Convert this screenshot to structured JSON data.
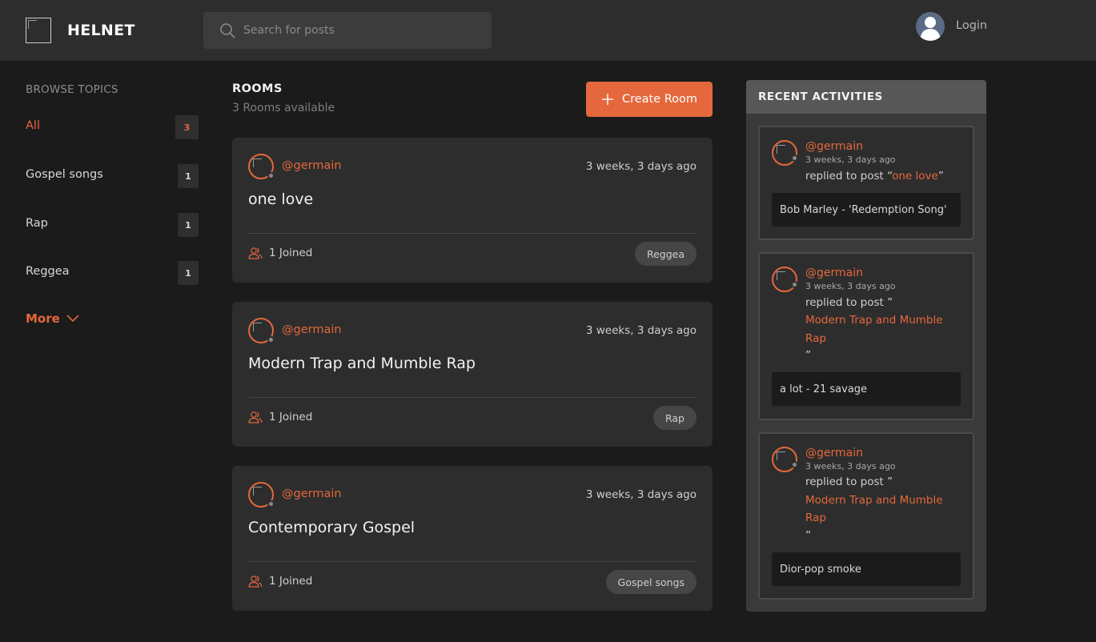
{
  "brand": {
    "name": "HELNET"
  },
  "search": {
    "placeholder": "Search for posts"
  },
  "header": {
    "login_label": "Login"
  },
  "sidebar": {
    "title": "BROWSE TOPICS",
    "topics": [
      {
        "label": "All",
        "count": "3"
      },
      {
        "label": "Gospel songs",
        "count": "1"
      },
      {
        "label": "Rap",
        "count": "1"
      },
      {
        "label": "Reggea",
        "count": "1"
      }
    ],
    "more_label": "More"
  },
  "rooms": {
    "title": "ROOMS",
    "subtitle": "3 Rooms available",
    "create_label": "Create Room",
    "items": [
      {
        "host": "@germain",
        "time": "3 weeks, 3 days ago",
        "name": "one love",
        "joined": "1 Joined",
        "topic": "Reggea"
      },
      {
        "host": "@germain",
        "time": "3 weeks, 3 days ago",
        "name": "Modern Trap and Mumble Rap",
        "joined": "1 Joined",
        "topic": "Rap"
      },
      {
        "host": "@germain",
        "time": "3 weeks, 3 days ago",
        "name": "Contemporary Gospel",
        "joined": "1 Joined",
        "topic": "Gospel songs"
      }
    ]
  },
  "activities": {
    "title": "RECENT ACTIVITIES",
    "items": [
      {
        "user": "@germain",
        "time": "3 weeks, 3 days ago",
        "action": "replied to post “",
        "post": "one love",
        "close": "”",
        "body": "Bob Marley - 'Redemption Song'"
      },
      {
        "user": "@germain",
        "time": "3 weeks, 3 days ago",
        "action": "replied to post ”",
        "post_line1": "Modern Trap and Mumble",
        "post_line2": "Rap",
        "close": "”",
        "body": "a lot - 21 savage"
      },
      {
        "user": "@germain",
        "time": "3 weeks, 3 days ago",
        "action": "replied to post ”",
        "post_line1": "Modern Trap and Mumble",
        "post_line2": "Rap",
        "close": "”",
        "body": "Dior-pop smoke"
      }
    ]
  },
  "colors": {
    "accent": "#e4683c",
    "background": "#1b1b1b",
    "card": "#2d2d2d",
    "header": "#2d2d2d"
  },
  "icons": [
    "search-icon",
    "user-avatar-icon",
    "chevron-down-icon",
    "plus-icon",
    "users-icon"
  ]
}
